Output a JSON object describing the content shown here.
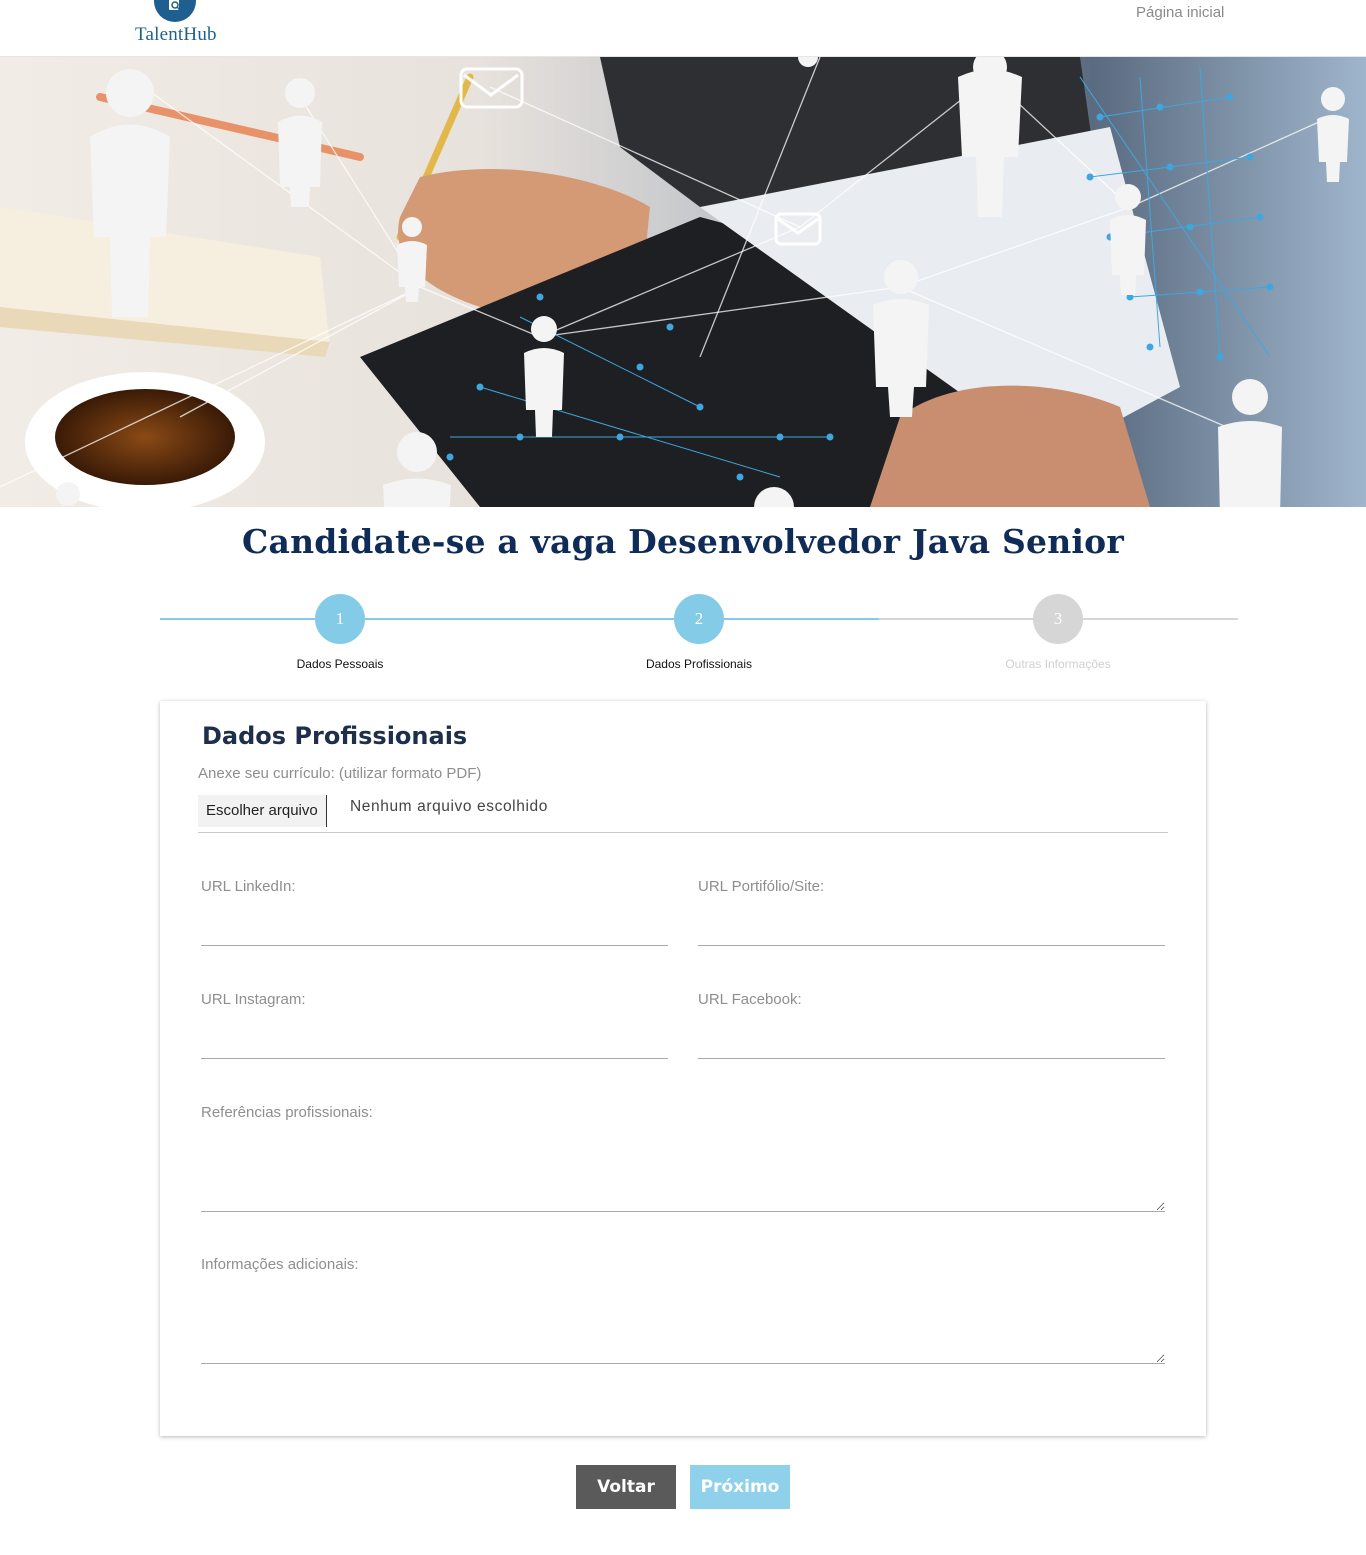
{
  "header": {
    "logo_text": "TalentHub",
    "nav_home": "Página inicial"
  },
  "hero": {
    "image_description": ""
  },
  "page_title": "Candidate-se a vaga Desenvolvedor Java Senior",
  "stepper": {
    "steps": [
      {
        "number": "1",
        "label": "Dados Pessoais",
        "state": "done"
      },
      {
        "number": "2",
        "label": "Dados Profissionais",
        "state": "active"
      },
      {
        "number": "3",
        "label": "Outras Informações",
        "state": "pending"
      }
    ],
    "colors": {
      "active": "#84cbe7",
      "inactive": "#d6d6d6"
    }
  },
  "form": {
    "title": "Dados Profissionais",
    "resume_label": "Anexe seu currículo: (utilizar formato PDF)",
    "file_button": "Escolher arquivo",
    "file_status": "Nenhum arquivo escolhido",
    "linkedin_label": "URL LinkedIn:",
    "portfolio_label": "URL Portifólio/Site:",
    "instagram_label": "URL Instagram:",
    "facebook_label": "URL Facebook:",
    "references_label": "Referências profissionais:",
    "additional_label": "Informações adicionais:"
  },
  "buttons": {
    "back": "Voltar",
    "next": "Próximo"
  }
}
